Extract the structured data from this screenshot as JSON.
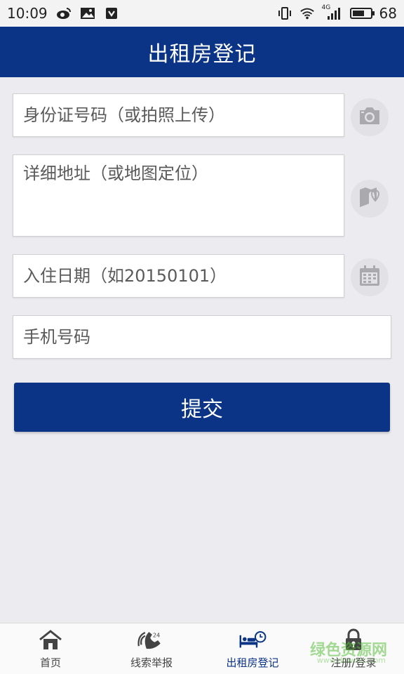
{
  "status_bar": {
    "time": "10:09",
    "signal_label": "4G",
    "battery": "68",
    "battery_fraction": 0.68,
    "left_icons": [
      "weibo-icon",
      "image-icon",
      "shield-icon"
    ],
    "right_icons": [
      "vibrate-icon",
      "wifi-icon",
      "signal-icon",
      "battery-icon"
    ]
  },
  "header": {
    "title": "出租房登记"
  },
  "form": {
    "id_number": {
      "placeholder": "身份证号码（或拍照上传）",
      "value": "",
      "action_icon": "camera-icon"
    },
    "address": {
      "placeholder": "详细地址（或地图定位）",
      "value": "",
      "action_icon": "map-icon"
    },
    "checkin_date": {
      "placeholder": "入住日期（如20150101）",
      "value": "",
      "action_icon": "calendar-icon"
    },
    "phone": {
      "placeholder": "手机号码",
      "value": ""
    },
    "submit_label": "提交"
  },
  "bottom_nav": {
    "items": [
      {
        "label": "首页",
        "icon": "home-icon",
        "active": false
      },
      {
        "label": "线索举报",
        "icon": "hotline-24-icon",
        "active": false
      },
      {
        "label": "出租房登记",
        "icon": "bed-clock-icon",
        "active": true
      },
      {
        "label": "注册/登录",
        "icon": "lock-icon",
        "active": false
      }
    ]
  },
  "watermark": {
    "title": "绿色资源网",
    "url": "www.downcc.com"
  },
  "colors": {
    "primary": "#0b3486",
    "background": "#ebebf0",
    "icon_gray": "#a9a9ae"
  }
}
